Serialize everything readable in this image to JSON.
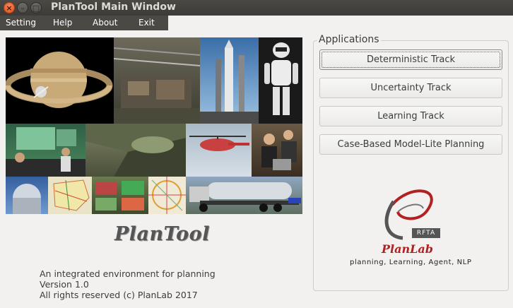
{
  "window": {
    "title": "PlanTool Main Window",
    "controls": {
      "close": "×",
      "minimize": "–",
      "maximize": "□"
    }
  },
  "menu": {
    "items": [
      "Setting",
      "Help",
      "About",
      "Exit"
    ]
  },
  "branding": {
    "app_logo_text": "PlanTool",
    "description": "An integrated environment for planning",
    "version": "Version 1.0",
    "copyright": "All rights reserved (c) PlanLab 2017"
  },
  "applications": {
    "group_title": "Applications",
    "buttons": [
      "Deterministic Track",
      "Uncertainty Track",
      "Learning Track",
      "Case-Based Model-Lite Planning"
    ],
    "focused_index": 0
  },
  "lab": {
    "logo_badge": "RFTA",
    "name": "PlanLab",
    "tagline": "planning, Learning, Agent, NLP"
  },
  "colors": {
    "titlebar": "#3c3b37",
    "menubar": "#4a4944",
    "window_bg": "#f2f1f0",
    "lab_red": "#b32020"
  }
}
